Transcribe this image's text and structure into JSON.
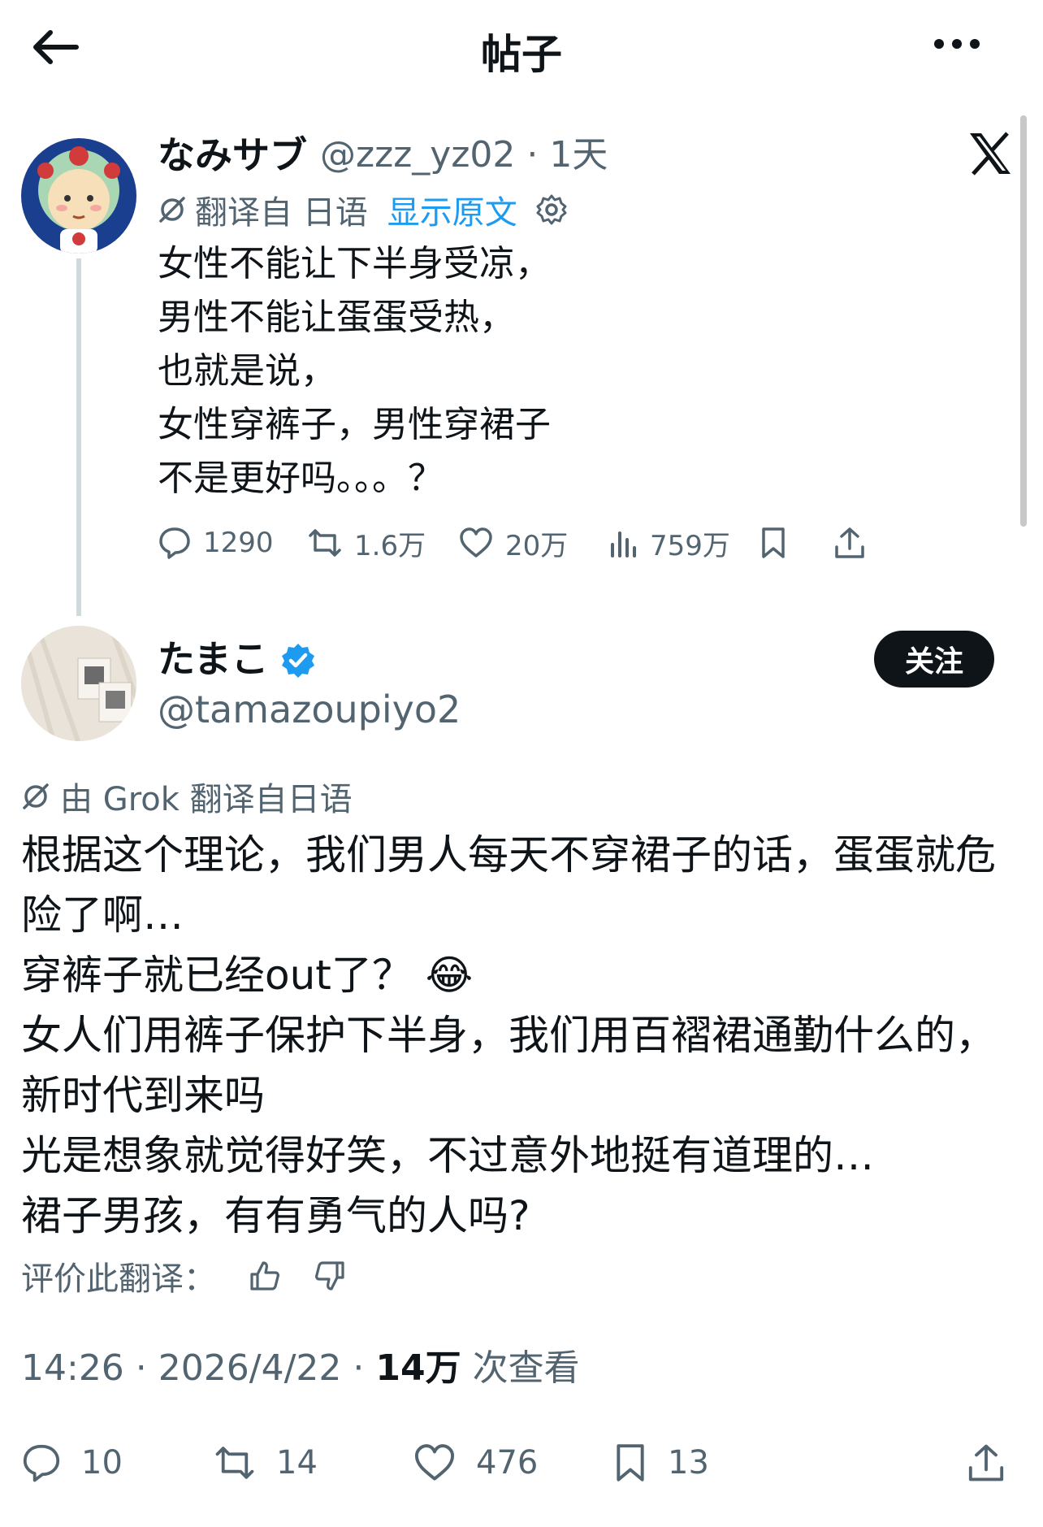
{
  "header": {
    "title": "帖子",
    "back_icon": "arrow-left-icon",
    "more_icon": "more-horizontal-icon"
  },
  "quoted": {
    "name": "なみサブ",
    "handle": "@zzz_yz02",
    "time": "1天",
    "translated_from": "翻译自 日语",
    "show_original": "显示原文",
    "text": "女性不能让下半身受凉，\n男性不能让蛋蛋受热，\n也就是说，\n女性穿裤子，男性穿裙子\n不是更好吗。。。？",
    "replies": "1290",
    "reposts": "1.6万",
    "likes": "20万",
    "views": "759万"
  },
  "post": {
    "name": "たまこ",
    "handle": "@tamazoupiyo2",
    "follow_label": "关注",
    "grok_translated": "由 Grok 翻译自日语",
    "text": "根据这个理论，我们男人每天不穿裙子的话，蛋蛋就危险了啊…\n穿裤子就已经out了？ 😂\n女人们用裤子保护下半身，我们用百褶裙通勤什么的，新时代到来吗\n光是想象就觉得好笑，不过意外地挺有道理的…\n裙子男孩，有有勇气的人吗?",
    "rate_label": "评价此翻译：",
    "time": "14:26",
    "date": "2026/4/22",
    "views_count": "14万",
    "views_label": "次查看",
    "replies": "10",
    "reposts": "14",
    "likes": "476",
    "bookmarks": "13"
  },
  "colors": {
    "text": "#0f1419",
    "secondary": "#536471",
    "accent": "#1d9bf0",
    "verified": "#1d9bf0"
  }
}
